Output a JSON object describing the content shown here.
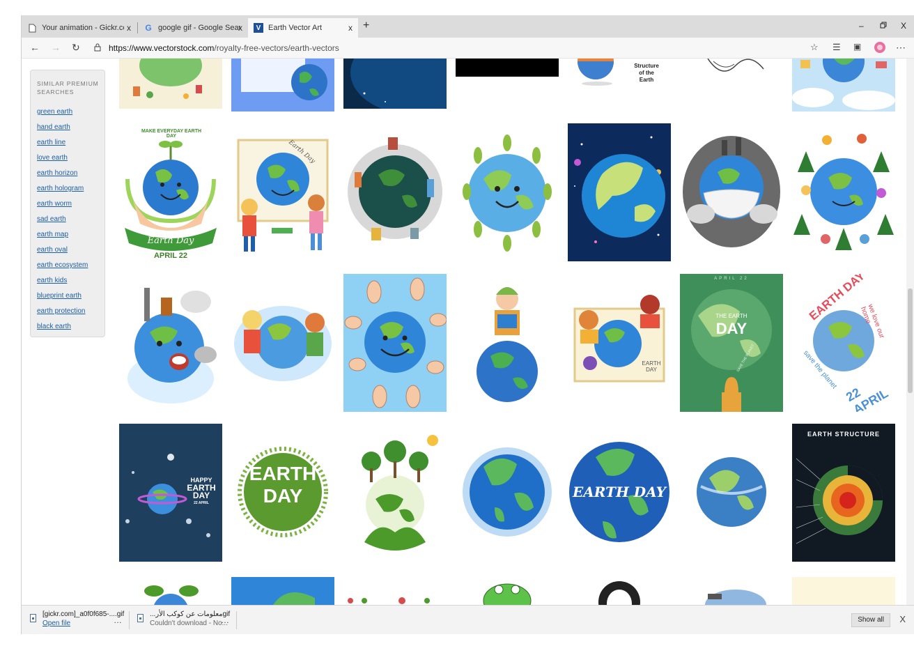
{
  "browser": {
    "tabs": [
      {
        "label": "Your animation - Gickr.com - Be",
        "close": "x"
      },
      {
        "label": "google gif - Google Search",
        "close": "x"
      },
      {
        "label": "Earth Vector Art",
        "close": "x"
      }
    ],
    "new_tab": "+",
    "window_controls": {
      "minimize": "–",
      "restore": "▢",
      "close": "X"
    },
    "url_host": "https://www.vectorstock.com",
    "url_path": "/royalty-free-vectors/earth-vectors"
  },
  "sidebar": {
    "heading": "SIMILAR PREMIUM SEARCHES",
    "links": [
      "green earth",
      "hand earth",
      "earth line",
      "love earth",
      "earth horizon",
      "earth hologram",
      "earth worm",
      "sad earth",
      "earth map",
      "earth oval",
      "earth ecosystem",
      "earth kids",
      "blueprint earth",
      "earth protection",
      "black earth"
    ]
  },
  "tiles": {
    "structure_small": [
      "Structure",
      "of the",
      "Earth"
    ],
    "earthday_hands_ring": "MAKE EVERYDAY EARTH DAY",
    "earthday_hands_banner": "Earth Day",
    "earthday_hands_date": "APRIL 22",
    "kids_poster": "Earth Day",
    "kids_poster2": [
      "EARTH",
      "DAY"
    ],
    "green_poster": [
      "THE EARTH",
      "DAY"
    ],
    "green_poster_top": "APRIL 22",
    "green_poster_side": "SAVE THE PLANET",
    "round_ring": "EARTH DAY",
    "round_ring2": "we love our home",
    "round_ring3": "save the planet",
    "round_date": "22 APRIL",
    "happy_earth": [
      "HAPPY",
      "EARTH",
      "DAY",
      "22 APRIL"
    ],
    "earth_day_big": [
      "EARTH",
      "DAY"
    ],
    "earth_day_blue": "EARTH DAY",
    "structure_dark": "EARTH STRUCTURE"
  },
  "downloads": [
    {
      "name": "[gickr.com]_a0f0f685-....gif",
      "action": "Open file"
    },
    {
      "name": "...معلومات عن كوكب الأرgif",
      "status": "Couldn't download - No..."
    }
  ],
  "download_more": "…",
  "show_all": "Show all",
  "close_bar": "X",
  "colors": {
    "link": "#1a5fa8",
    "tabstrip": "#dcdcdc",
    "accent_green": "#4a8f3a",
    "ocean": "#2a7bd0"
  }
}
